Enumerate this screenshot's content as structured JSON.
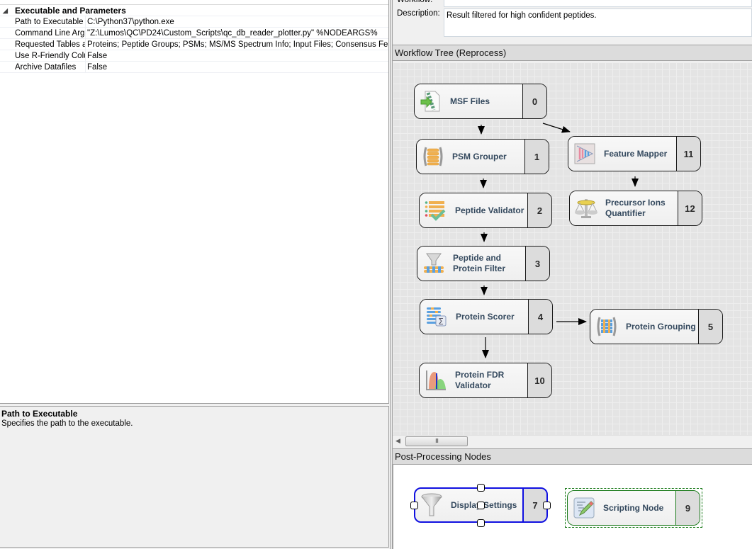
{
  "properties": {
    "category": "Executable and Parameters",
    "rows": [
      {
        "key": "Path to Executable",
        "value": "C:\\Python37\\python.exe"
      },
      {
        "key": "Command Line Argu",
        "value": "\"Z:\\Lumos\\QC\\PD24\\Custom_Scripts\\qc_db_reader_plotter.py\" %NODEARGS%"
      },
      {
        "key": "Requested Tables a",
        "value": "Proteins; Peptide Groups; PSMs; MS/MS Spectrum Info; Input Files; Consensus Features"
      },
      {
        "key": "Use R-Friendly Colur",
        "value": "False"
      },
      {
        "key": "Archive Datafiles",
        "value": "False"
      }
    ]
  },
  "help": {
    "title": "Path to Executable",
    "description": "Specifies the path to the executable."
  },
  "workflow": {
    "name_label": "Workflow:",
    "name_value": "",
    "description_label": "Description:",
    "description_value": "Result filtered for high confident peptides."
  },
  "tree": {
    "header": "Workflow Tree (Reprocess)",
    "nodes": [
      {
        "id": "msf",
        "label": "MSF Files",
        "number": "0",
        "icon": "msf-files-icon"
      },
      {
        "id": "psm",
        "label": "PSM Grouper",
        "number": "1",
        "icon": "psm-grouper-icon"
      },
      {
        "id": "fmap",
        "label": "Feature Mapper",
        "number": "11",
        "icon": "feature-mapper-icon"
      },
      {
        "id": "pval",
        "label": "Peptide Validator",
        "number": "2",
        "icon": "peptide-validator-icon"
      },
      {
        "id": "piq",
        "label_line1": "Precursor Ions",
        "label_line2": "Quantifier",
        "number": "12",
        "icon": "scales-icon"
      },
      {
        "id": "ppf",
        "label_line1": "Peptide and",
        "label_line2": "Protein Filter",
        "number": "3",
        "icon": "funnel-filter-icon"
      },
      {
        "id": "pscore",
        "label": "Protein Scorer",
        "number": "4",
        "icon": "protein-scorer-icon"
      },
      {
        "id": "pgroup",
        "label": "Protein Grouping",
        "number": "5",
        "icon": "protein-grouping-icon"
      },
      {
        "id": "pfdr",
        "label_line1": "Protein FDR",
        "label_line2": "Validator",
        "number": "10",
        "icon": "fdr-chart-icon"
      }
    ],
    "scroll_thumb": "III"
  },
  "post": {
    "header": "Post-Processing Nodes",
    "nodes": [
      {
        "id": "display",
        "label": "Display Settings",
        "number": "7",
        "icon": "funnel-icon",
        "selected": true
      },
      {
        "id": "script",
        "label": "Scripting Node",
        "number": "9",
        "icon": "scripting-icon",
        "selected": false
      }
    ]
  },
  "colors": {
    "selection_blue": "#1010e0",
    "scripting_green": "#1a7a1a",
    "node_label": "#34495e"
  }
}
